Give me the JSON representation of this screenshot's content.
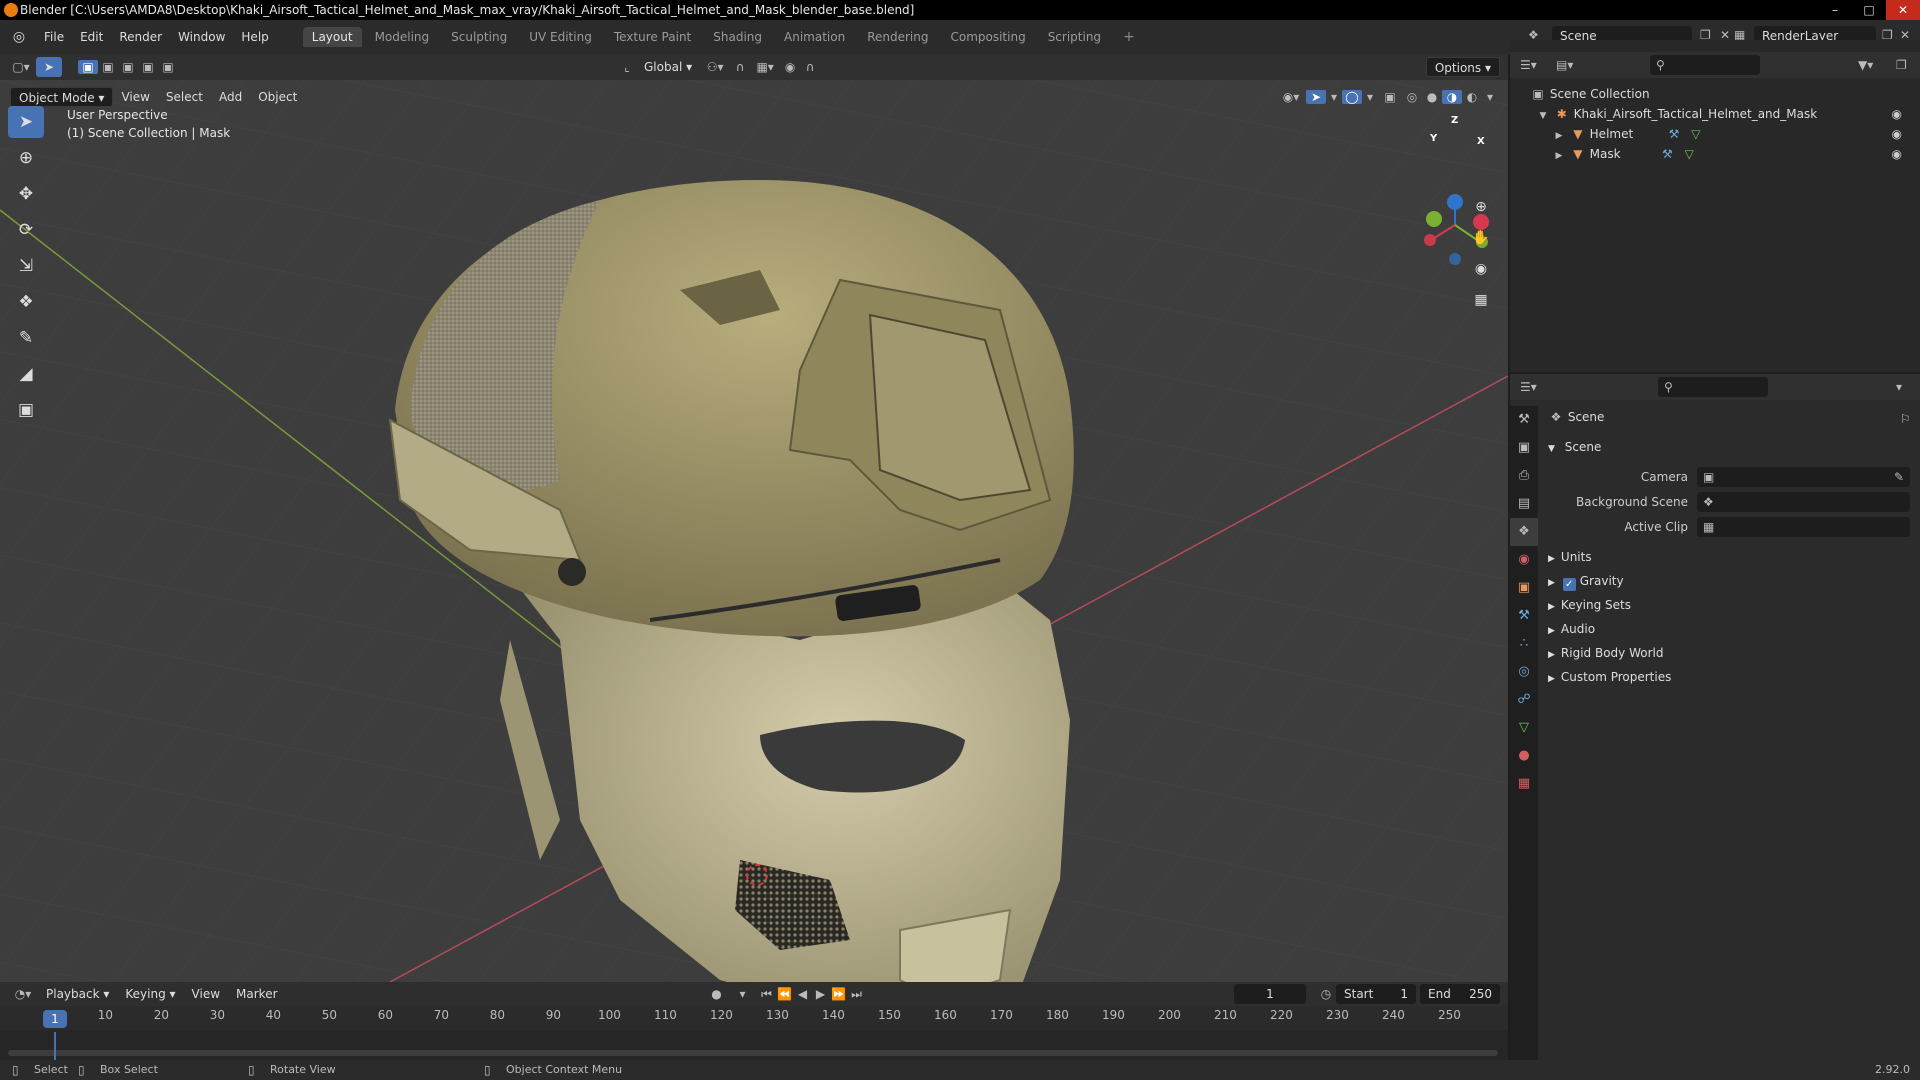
{
  "titlebar": {
    "title": "Blender [C:\\Users\\AMDA8\\Desktop\\Khaki_Airsoft_Tactical_Helmet_and_Mask_max_vray/Khaki_Airsoft_Tactical_Helmet_and_Mask_blender_base.blend]",
    "minimize": "–",
    "maximize": "□",
    "close": "✕"
  },
  "menubar": {
    "items": [
      "File",
      "Edit",
      "Render",
      "Window",
      "Help"
    ]
  },
  "workspaces": {
    "tabs": [
      "Layout",
      "Modeling",
      "Sculpting",
      "UV Editing",
      "Texture Paint",
      "Shading",
      "Animation",
      "Rendering",
      "Compositing",
      "Scripting"
    ],
    "active": "Layout",
    "add": "+"
  },
  "scene_selector": {
    "value": "Scene"
  },
  "layer_selector": {
    "value": "RenderLayer"
  },
  "viewport": {
    "transform_orientation": "Global",
    "options": "Options",
    "mode": "Object Mode",
    "menus": [
      "View",
      "Select",
      "Add",
      "Object"
    ],
    "perspective": "User Perspective",
    "collection_info": "(1) Scene Collection | Mask",
    "gizmo": {
      "x": "X",
      "y": "Y",
      "z": "Z"
    },
    "background": "#3d3d3d",
    "grid_color": "#474747",
    "x_axis_color": "#b44b5a",
    "y_axis_color": "#7a9a3a"
  },
  "tools": [
    "select-box",
    "cursor",
    "move",
    "rotate",
    "scale",
    "transform",
    "annotate",
    "measure",
    "add-cube"
  ],
  "outliner": {
    "root": "Scene Collection",
    "items": [
      {
        "label": "Khaki_Airsoft_Tactical_Helmet_and_Mask",
        "indent": 1
      },
      {
        "label": "Helmet",
        "indent": 2
      },
      {
        "label": "Mask",
        "indent": 2
      }
    ]
  },
  "properties": {
    "breadcrumb": "Scene",
    "panel_title": "Scene",
    "fields": [
      {
        "label": "Camera"
      },
      {
        "label": "Background Scene"
      },
      {
        "label": "Active Clip"
      }
    ],
    "sections": [
      "Units",
      "Gravity",
      "Keying Sets",
      "Audio",
      "Rigid Body World",
      "Custom Properties"
    ],
    "gravity_checked": true
  },
  "timeline": {
    "menus": [
      "Playback",
      "Keying",
      "View",
      "Marker"
    ],
    "current_frame": "1",
    "start_label": "Start",
    "start": "1",
    "end_label": "End",
    "end": "250",
    "ticks": [
      "1",
      "10",
      "20",
      "30",
      "40",
      "50",
      "60",
      "70",
      "80",
      "90",
      "100",
      "110",
      "120",
      "130",
      "140",
      "150",
      "160",
      "170",
      "180",
      "190",
      "200",
      "210",
      "220",
      "230",
      "240",
      "250"
    ]
  },
  "statusbar": {
    "select": "Select",
    "box_select": "Box Select",
    "rotate_view": "Rotate View",
    "context_menu": "Object Context Menu",
    "version": "2.92.0"
  },
  "colors": {
    "accent": "#4772b3",
    "helmet": "#a49a6a",
    "mask": "#b9b190",
    "blender_orange": "#e87d0d"
  }
}
